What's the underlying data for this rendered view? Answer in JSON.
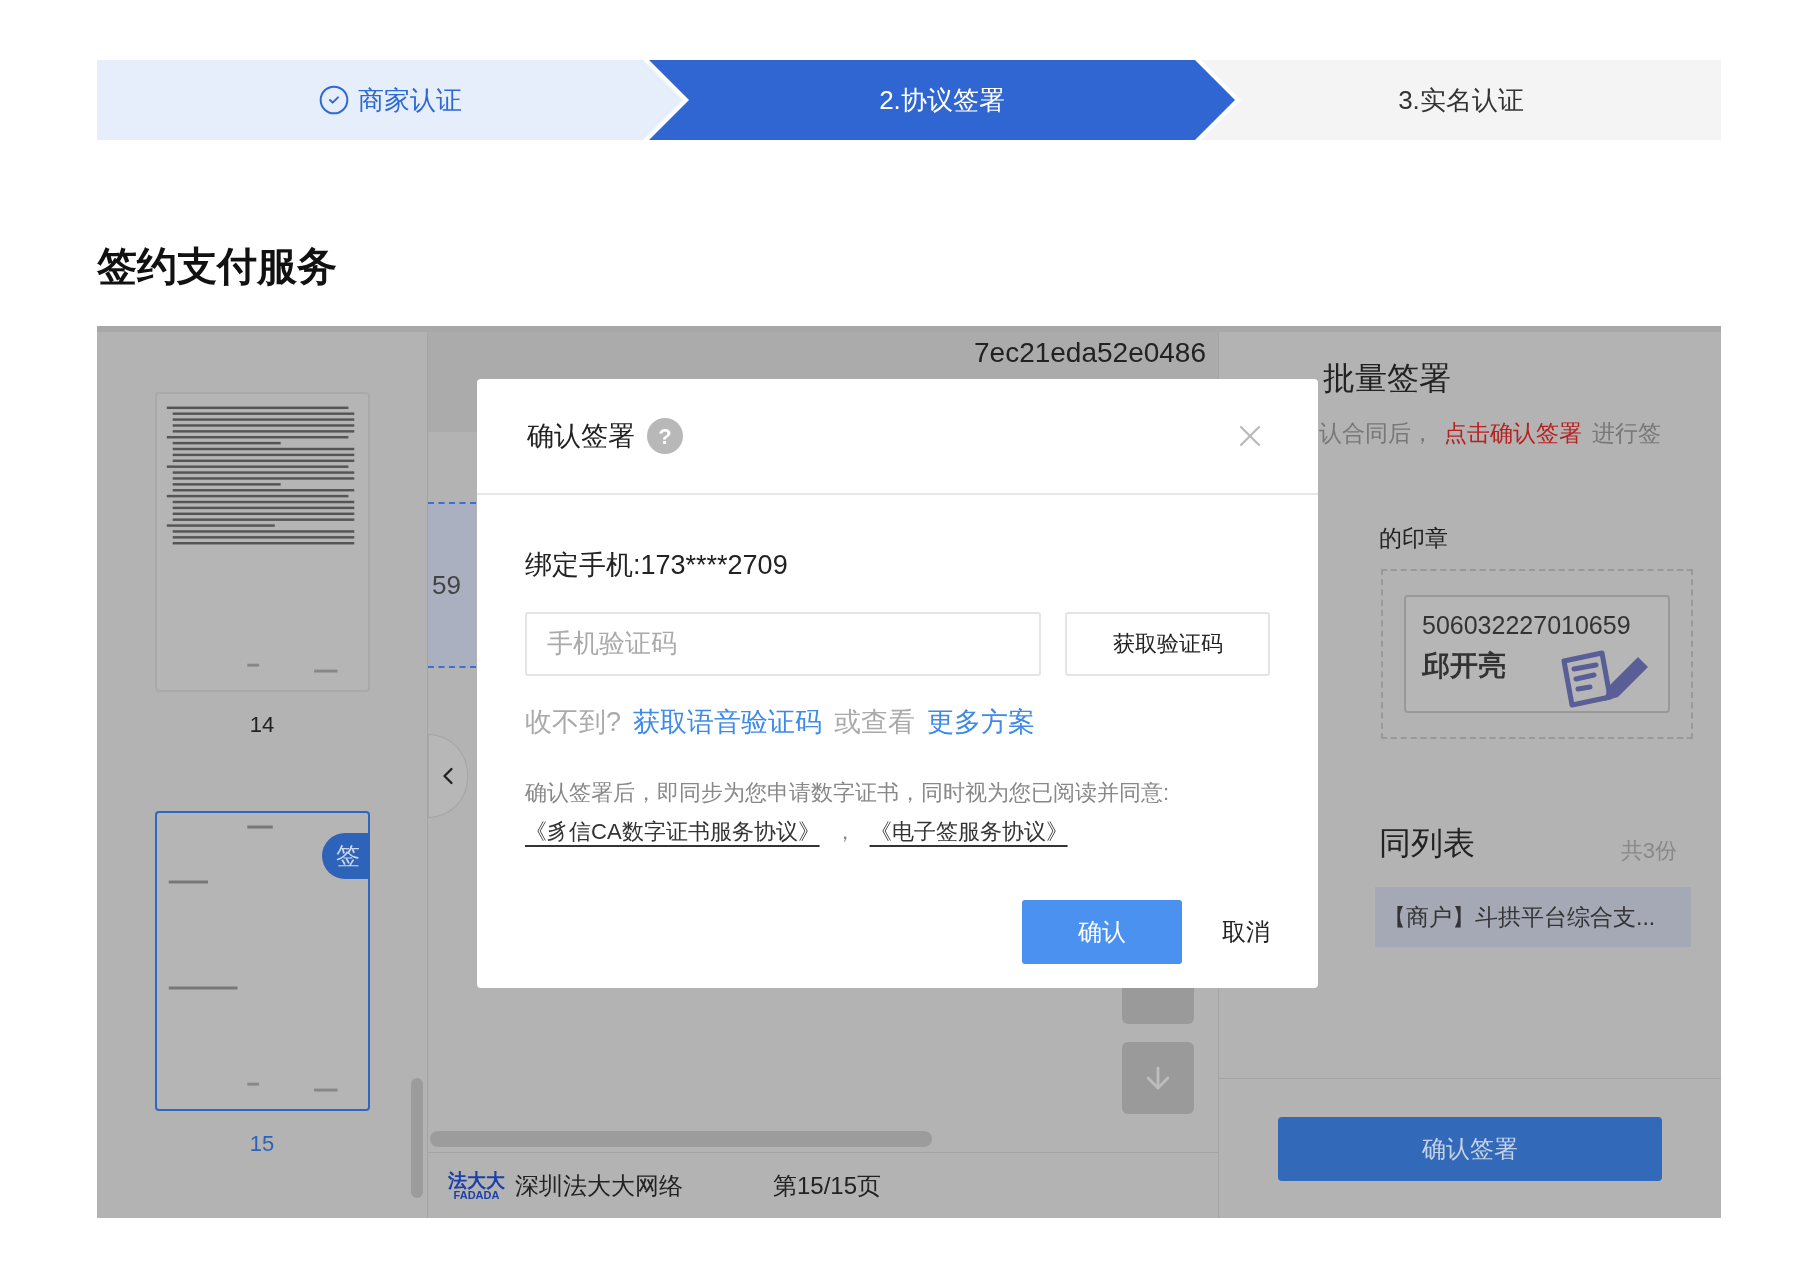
{
  "steps": [
    {
      "label": "商家认证",
      "done": true,
      "selected": false
    },
    {
      "label": "2.协议签署",
      "done": false,
      "selected": true
    },
    {
      "label": "3.实名认证",
      "done": false,
      "selected": false
    }
  ],
  "heading": "签约支付服务",
  "thumbnails": [
    {
      "page": "14",
      "selected": false,
      "kind": "text"
    },
    {
      "page": "15",
      "selected": true,
      "kind": "signature",
      "badge": "签"
    }
  ],
  "viewer": {
    "doc_id": "7ec21eda52e0486",
    "seal_fragment": "59",
    "brand_logo": "法大大",
    "brand_logo_sub": "FADADA",
    "company": "深圳法大大网络",
    "page_indicator": "第15/15页"
  },
  "side_panel": {
    "title": "批量签署",
    "hint_prefix": "认合同后，",
    "hint_action": "点击确认签署",
    "hint_suffix": "进行签",
    "seal_label": "的印章",
    "seal": {
      "number": "506032227010659",
      "name": "邱开亮"
    },
    "list_title": "同列表",
    "list_count": "共3份",
    "list_items": [
      {
        "label": "【商户】斗拱平台综合支...",
        "selected": true
      }
    ],
    "confirm_button": "确认签署"
  },
  "dialog": {
    "title": "确认签署",
    "help": "?",
    "phone_label": "绑定手机:173****2709",
    "code_field": {
      "placeholder": "手机验证码"
    },
    "get_code_button": "获取验证码",
    "no_code": "收不到?",
    "voice_code_link": "获取语音验证码",
    "or_view": "或查看",
    "more_link": "更多方案",
    "notice": "确认签署后，即同步为您申请数字证书，同时视为您已阅读并同意:",
    "agreements": [
      "《豸信CA数字证书服务协议》",
      "《电子签服务协议》"
    ],
    "separator": "，",
    "confirm": "确认",
    "cancel": "取消"
  }
}
